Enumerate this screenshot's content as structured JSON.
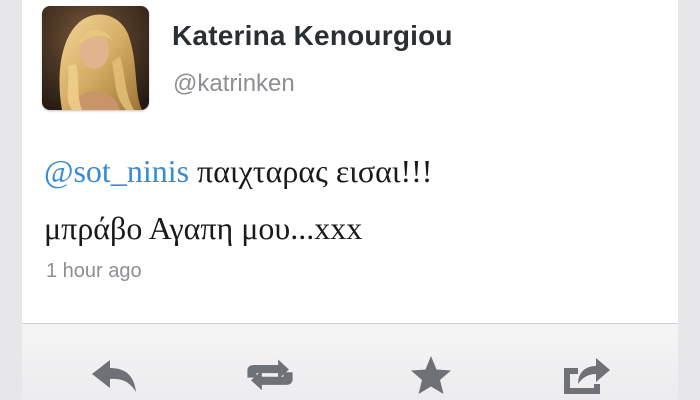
{
  "tweet": {
    "display_name": "Katerina Kenourgiou",
    "handle": "@katrinken",
    "mention": "@sot_ninis",
    "text_line1_rest": " παιχταρας εισαι!!!",
    "text_line2": "μπράβο Αγαπη μου...xxx",
    "timestamp": "1 hour ago"
  },
  "actions": [
    {
      "name": "reply",
      "icon": "reply-icon"
    },
    {
      "name": "retweet",
      "icon": "retweet-icon"
    },
    {
      "name": "favorite",
      "icon": "star-icon"
    },
    {
      "name": "share",
      "icon": "share-icon"
    }
  ],
  "colors": {
    "mention": "#3a8ad4",
    "name": "#292f33",
    "muted": "#8e8e93",
    "icon": "#6e7276"
  }
}
